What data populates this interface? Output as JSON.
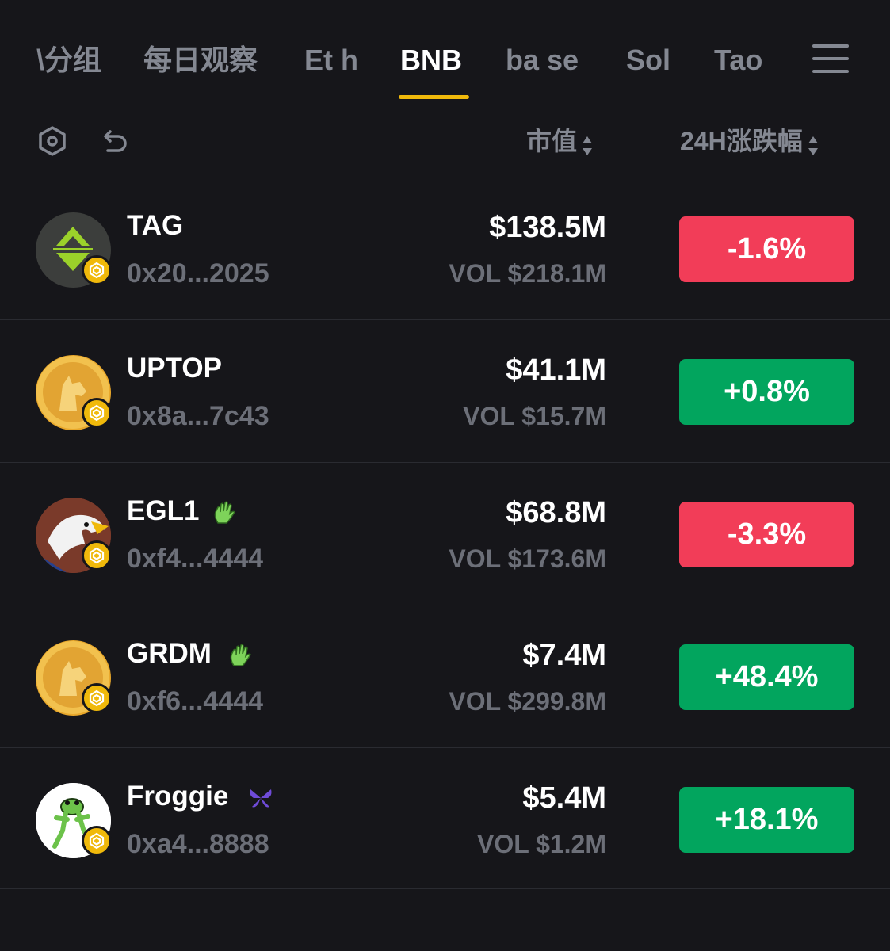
{
  "tabs": [
    {
      "label": "\\分组"
    },
    {
      "label": "每日观察"
    },
    {
      "label": "Et h"
    },
    {
      "label": "BNB"
    },
    {
      "label": "ba se"
    },
    {
      "label": "Sol"
    },
    {
      "label": "Tao"
    }
  ],
  "active_tab_index": 3,
  "toolbar": {
    "market_cap_label": "市值",
    "change_label": "24H涨跌幅"
  },
  "tokens": [
    {
      "name": "TAG",
      "address": "0x20...2025",
      "market_cap": "$138.5M",
      "volume": "VOL $218.1M",
      "change": "-1.6%",
      "direction": "down"
    },
    {
      "name": "UPTOP",
      "address": "0x8a...7c43",
      "market_cap": "$41.1M",
      "volume": "VOL $15.7M",
      "change": "+0.8%",
      "direction": "up"
    },
    {
      "name": "EGL1",
      "address": "0xf4...4444",
      "market_cap": "$68.8M",
      "volume": "VOL $173.6M",
      "change": "-3.3%",
      "direction": "down",
      "badge_icon": "waving-hand-icon"
    },
    {
      "name": "GRDM",
      "address": "0xf6...4444",
      "market_cap": "$7.4M",
      "volume": "VOL $299.8M",
      "change": "+48.4%",
      "direction": "up",
      "badge_icon": "waving-hand-icon"
    },
    {
      "name": "Froggie",
      "address": "0xa4...8888",
      "market_cap": "$5.4M",
      "volume": "VOL $1.2M",
      "change": "+18.1%",
      "direction": "up",
      "badge_icon": "butterfly-icon"
    }
  ],
  "colors": {
    "background": "#16161a",
    "accent": "#f0b90b",
    "negative": "#f23d58",
    "positive": "#02a55e",
    "muted_text": "#848892"
  }
}
